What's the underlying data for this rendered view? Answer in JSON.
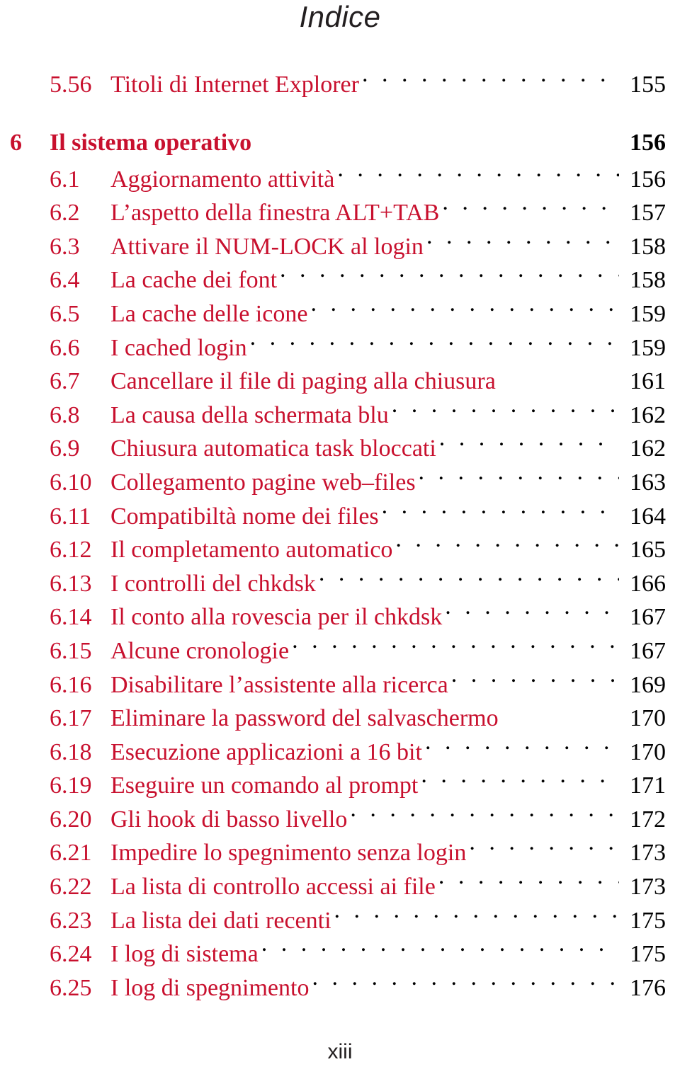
{
  "document": {
    "heading": "Indice",
    "folio": "xiii",
    "accent_color": "#c8102e",
    "page_number_color": "#000000",
    "leader_color": "#000000",
    "background_color": "#ffffff"
  },
  "toc": {
    "entries": [
      {
        "level": "section",
        "number": "5.56",
        "title": "Titoli di Internet Explorer",
        "page": "155",
        "leader": true
      },
      {
        "level": "chapter",
        "number": "6",
        "title": "Il sistema operativo",
        "page": "156",
        "leader": false
      },
      {
        "level": "section",
        "number": "6.1",
        "title": "Aggiornamento attività",
        "page": "156",
        "leader": true
      },
      {
        "level": "section",
        "number": "6.2",
        "title": "L’aspetto della finestra ALT+TAB",
        "page": "157",
        "leader": true
      },
      {
        "level": "section",
        "number": "6.3",
        "title": "Attivare il NUM-LOCK al login",
        "page": "158",
        "leader": true
      },
      {
        "level": "section",
        "number": "6.4",
        "title": "La cache dei font",
        "page": "158",
        "leader": true
      },
      {
        "level": "section",
        "number": "6.5",
        "title": "La cache delle icone",
        "page": "159",
        "leader": true
      },
      {
        "level": "section",
        "number": "6.6",
        "title": "I cached login",
        "page": "159",
        "leader": true
      },
      {
        "level": "section",
        "number": "6.7",
        "title": "Cancellare il file di paging alla chiusura",
        "page": "161",
        "leader": false
      },
      {
        "level": "section",
        "number": "6.8",
        "title": "La causa della schermata blu",
        "page": "162",
        "leader": true
      },
      {
        "level": "section",
        "number": "6.9",
        "title": "Chiusura automatica task bloccati",
        "page": "162",
        "leader": true
      },
      {
        "level": "section",
        "number": "6.10",
        "title": "Collegamento pagine web–files",
        "page": "163",
        "leader": true
      },
      {
        "level": "section",
        "number": "6.11",
        "title": "Compatibiltà nome dei files",
        "page": "164",
        "leader": true
      },
      {
        "level": "section",
        "number": "6.12",
        "title": "Il completamento automatico",
        "page": "165",
        "leader": true
      },
      {
        "level": "section",
        "number": "6.13",
        "title": "I controlli del chkdsk",
        "page": "166",
        "leader": true
      },
      {
        "level": "section",
        "number": "6.14",
        "title": "Il conto alla rovescia per il chkdsk",
        "page": "167",
        "leader": true
      },
      {
        "level": "section",
        "number": "6.15",
        "title": "Alcune cronologie",
        "page": "167",
        "leader": true
      },
      {
        "level": "section",
        "number": "6.16",
        "title": "Disabilitare l’assistente alla ricerca",
        "page": "169",
        "leader": true
      },
      {
        "level": "section",
        "number": "6.17",
        "title": "Eliminare la password del salvaschermo",
        "page": "170",
        "leader": false
      },
      {
        "level": "section",
        "number": "6.18",
        "title": "Esecuzione applicazioni a 16 bit",
        "page": "170",
        "leader": true
      },
      {
        "level": "section",
        "number": "6.19",
        "title": "Eseguire un comando al prompt",
        "page": "171",
        "leader": true
      },
      {
        "level": "section",
        "number": "6.20",
        "title": "Gli hook di basso livello",
        "page": "172",
        "leader": true
      },
      {
        "level": "section",
        "number": "6.21",
        "title": "Impedire lo spegnimento senza login",
        "page": "173",
        "leader": true
      },
      {
        "level": "section",
        "number": "6.22",
        "title": "La lista di controllo accessi ai file",
        "page": "173",
        "leader": true
      },
      {
        "level": "section",
        "number": "6.23",
        "title": "La lista dei dati recenti",
        "page": "175",
        "leader": true
      },
      {
        "level": "section",
        "number": "6.24",
        "title": "I log di sistema",
        "page": "175",
        "leader": true
      },
      {
        "level": "section",
        "number": "6.25",
        "title": "I log di spegnimento",
        "page": "176",
        "leader": true
      }
    ]
  }
}
